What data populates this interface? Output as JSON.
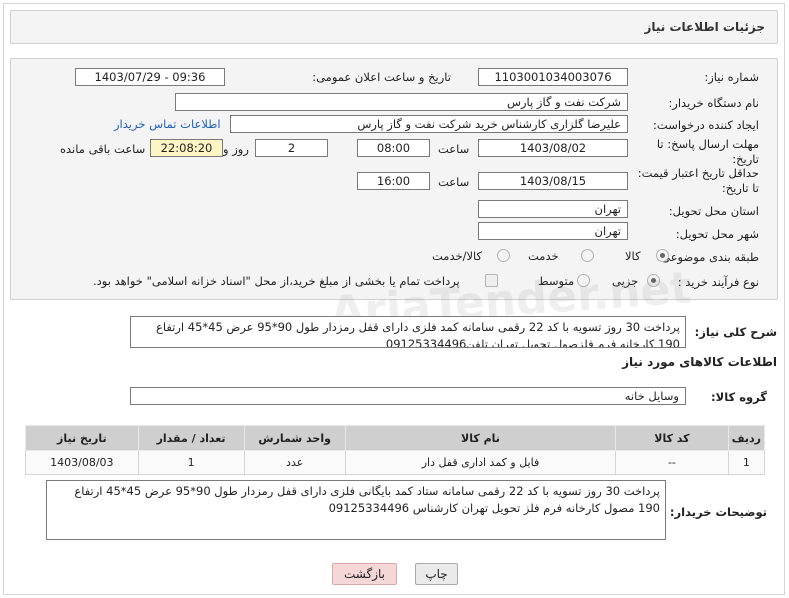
{
  "header": {
    "title": "جزئیات اطلاعات نیاز"
  },
  "form": {
    "need_number_label": "شماره نیاز:",
    "need_number": "1103001034003076",
    "announce_label": "تاریخ و ساعت اعلان عمومی:",
    "announce_value": "1403/07/29 - 09:36",
    "buyer_org_label": "نام دستگاه خریدار:",
    "buyer_org": "شرکت نفت و گاز پارس",
    "requester_label": "ایجاد کننده درخواست:",
    "requester": "علیرضا  گلزاری کارشناس خرید  شرکت نفت و گاز پارس",
    "contact_link": "اطلاعات تماس خریدار",
    "deadline_label": "مهلت ارسال پاسخ: تا تاریخ:",
    "deadline_date": "1403/08/02",
    "time_label": "ساعت",
    "deadline_time": "08:00",
    "days_value": "2",
    "days_label": "روز و",
    "remaining_time": "22:08:20",
    "remaining_label": "ساعت باقی مانده",
    "validity_label": "حداقل تاریخ اعتبار قیمت: تا تاریخ:",
    "validity_date": "1403/08/15",
    "validity_time": "16:00",
    "province_label": "استان محل تحویل:",
    "province": "تهران",
    "city_label": "شهر محل تحویل:",
    "city": "تهران",
    "category_label": "طبقه بندی موضوعی:",
    "category_options": [
      "کالا",
      "خدمت",
      "کالا/خدمت"
    ],
    "purchase_type_label": "نوع فرآیند خرید :",
    "purchase_options": [
      "جزیی",
      "متوسط"
    ],
    "payment_note": "پرداخت تمام یا بخشی از مبلغ خرید،از محل \"اسناد خزانه اسلامی\" خواهد بود."
  },
  "description": {
    "label": "شرح کلی نیاز:",
    "text": "پرداخت 30 روز تسویه با کد 22 رقمی سامانه کمد  فلزی دارای قفل رمزدار طول 90*95 عرض 45*45 ارتفاع 190 کارخانه فرم فلزصول  تحویل تهران تلفن09125334496"
  },
  "goods_section": {
    "title": "اطلاعات کالاهای مورد نیاز",
    "group_label": "گروه کالا:",
    "group_value": "وسایل خانه"
  },
  "table": {
    "headers": [
      "ردیف",
      "کد کالا",
      "نام کالا",
      "واحد شمارش",
      "تعداد / مقدار",
      "تاریخ نیاز"
    ],
    "rows": [
      [
        "1",
        "--",
        "فایل و کمد اداری قفل دار",
        "عدد",
        "1",
        "1403/08/03"
      ]
    ]
  },
  "buyer_notes": {
    "label": "توضیحات خریدار:",
    "text": "پرداخت 30 روز تسویه با کد 22 رقمی سامانه ستاد کمد بایگانی فلزی دارای قفل رمزدار طول 90*95 عرض 45*45 ارتفاع 190 مصول کارخانه فرم فلز تحویل تهران کارشناس 09125334496"
  },
  "buttons": {
    "print": "چاپ",
    "back": "بازگشت"
  },
  "watermark": "AriaTender.net",
  "colors": {
    "link": "#1f5fbf",
    "back_button": "#f6d7d7",
    "print_button": "#eaeaea",
    "remaining_bg": "#fdf5c4"
  }
}
